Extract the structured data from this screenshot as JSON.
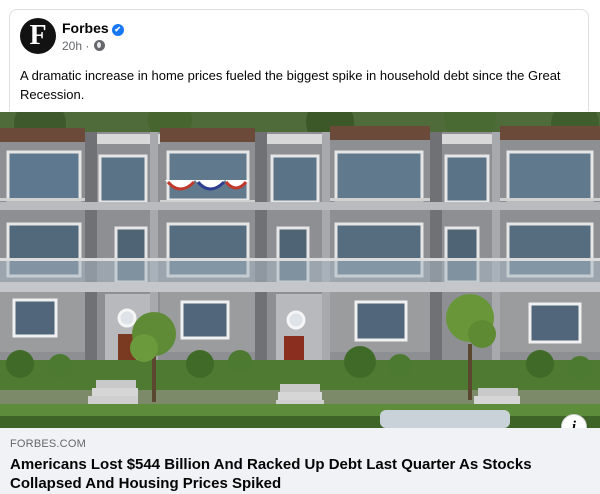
{
  "post": {
    "author": "Forbes",
    "avatar_letter": "F",
    "time": "20h",
    "meta_separator": "·",
    "text": "A dramatic increase in home prices fueled the biggest spike in household debt since the Great Recession.",
    "verified_glyph": "✔",
    "privacy_icon": "globe-icon"
  },
  "link_preview": {
    "domain": "FORBES.COM",
    "headline": "Americans Lost $544 Billion And Racked Up Debt Last Quarter As Stocks Collapsed And Housing Prices Spiked",
    "info_label": "i"
  },
  "colors": {
    "verified": "#1877f2",
    "link_box_bg": "#f0f2f5",
    "secondary_text": "#65676b"
  }
}
